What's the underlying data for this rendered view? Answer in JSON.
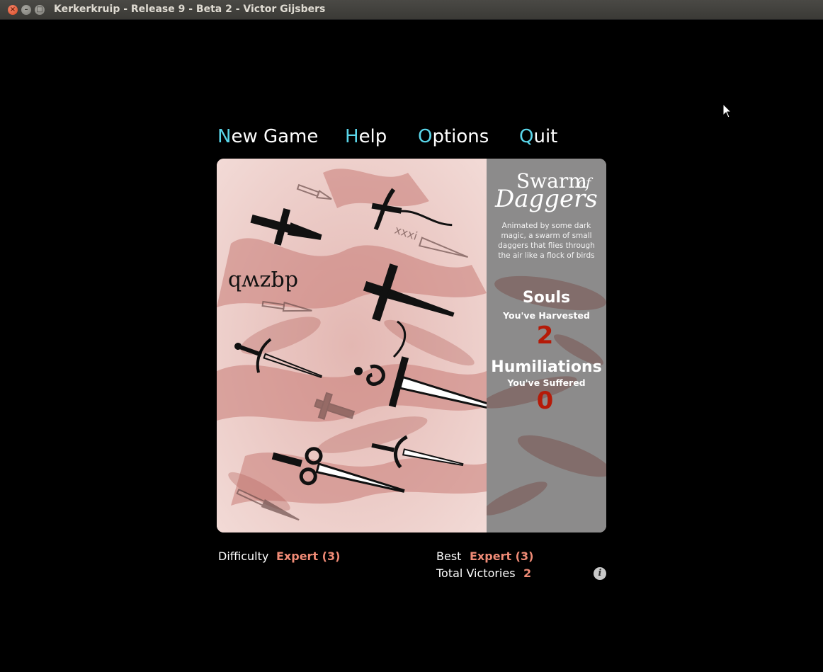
{
  "window": {
    "title": "Kerkerkruip - Release 9 - Beta 2 - Victor Gijsbers",
    "close_glyph": "×",
    "min_glyph": "–",
    "max_glyph": "□"
  },
  "menu": {
    "items": [
      {
        "key": "N",
        "rest": "ew Game"
      },
      {
        "key": "H",
        "rest": "elp"
      },
      {
        "key": "O",
        "rest": "ptions"
      },
      {
        "key": "Q",
        "rest": "uit"
      }
    ]
  },
  "card": {
    "title_line1": "Swarm",
    "title_of": "of",
    "title_line2": "Daggers",
    "description": "Animated by some dark magic, a swarm of small daggers  that flies through the air like a flock of birds",
    "souls_heading": "Souls",
    "souls_sub": "You've Harvested",
    "souls_value": "2",
    "humiliations_heading": "Humiliations",
    "humiliations_sub": "You've Suffered",
    "humiliations_value": "0"
  },
  "footer": {
    "difficulty_label": "Difficulty",
    "difficulty_value": "Expert (3)",
    "best_label": "Best",
    "best_value": "Expert (3)",
    "victories_label": "Total Victories",
    "victories_value": "2",
    "info_glyph": "i"
  },
  "colors": {
    "menu_key": "#5ad6ea",
    "footer_value": "#f08b76",
    "stat_value": "#b51a08"
  }
}
